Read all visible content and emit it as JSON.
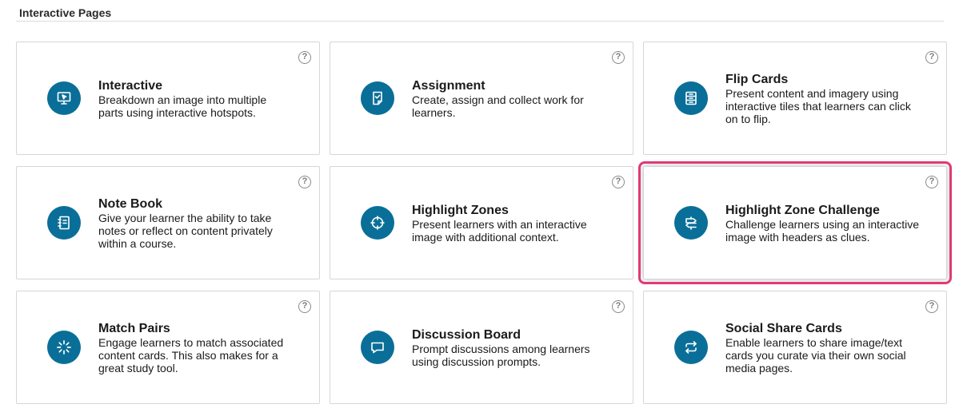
{
  "section": {
    "title": "Interactive Pages"
  },
  "help_glyph": "?",
  "accent_color": "#0a6f98",
  "highlight_color": "#e03a76",
  "cards": [
    {
      "title": "Interactive",
      "description": "Breakdown an image into multiple parts using interactive hotspots.",
      "icon": "monitor-cursor-icon"
    },
    {
      "title": "Assignment",
      "description": "Create, assign and collect work for learners.",
      "icon": "document-check-icon"
    },
    {
      "title": "Flip Cards",
      "description": "Present content and imagery using interactive tiles that learners can click on to flip.",
      "icon": "cards-icon"
    },
    {
      "title": "Note Book",
      "description": "Give your learner the ability to take notes or reflect on content privately within a course.",
      "icon": "notebook-icon"
    },
    {
      "title": "Highlight Zones",
      "description": "Present learners with an interactive image with additional context.",
      "icon": "crosshair-icon"
    },
    {
      "title": "Highlight Zone Challenge",
      "description": "Challenge learners using an interactive image with headers as clues.",
      "icon": "signpost-icon",
      "selected": true
    },
    {
      "title": "Match Pairs",
      "description": "Engage learners to match associated content cards. This also makes for a great study tool.",
      "icon": "spinner-icon"
    },
    {
      "title": "Discussion Board",
      "description": "Prompt discussions among learners using discussion prompts.",
      "icon": "speech-bubble-icon"
    },
    {
      "title": "Social Share Cards",
      "description": "Enable learners to share image/text cards you curate via their own social media pages.",
      "icon": "repeat-arrows-icon"
    }
  ]
}
